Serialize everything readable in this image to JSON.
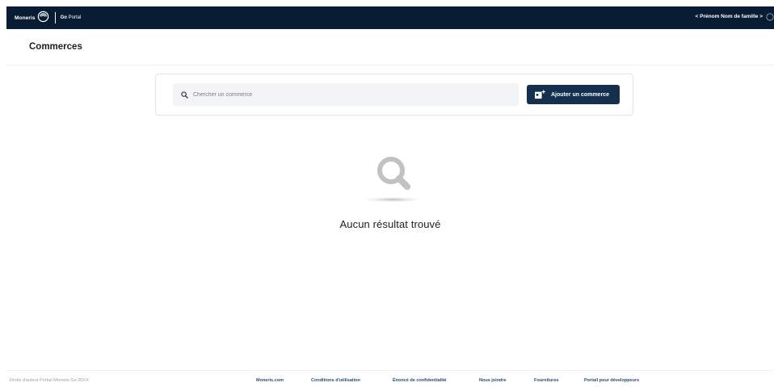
{
  "topbar": {
    "brand_name": "Moneris",
    "product_prefix": "Go",
    "product_name": "Portal",
    "user_label": "< Prénom Nom de famille >"
  },
  "page": {
    "title": "Commerces"
  },
  "search": {
    "placeholder": "Chercher un commerce",
    "value": ""
  },
  "actions": {
    "add_label": "Ajouter un commerce"
  },
  "empty_state": {
    "message": "Aucun résultat trouvé"
  },
  "footer": {
    "copyright": "Droits d'auteur Portail Moneris Go 20XX",
    "links": [
      "Moneris.com",
      "Conditions d'utilisation",
      "Énoncé de confidentialité",
      "Nous joindre",
      "Fournitures",
      "Portail pour développeurs"
    ]
  },
  "colors": {
    "topbar_bg": "#081d33",
    "primary_button": "#15304f",
    "link": "#2d4d6e",
    "search_bg": "#f3f4f6"
  },
  "icons": {
    "brand_logo": "moneris-logo-icon",
    "user": "user-circle-icon",
    "search": "search-icon",
    "add": "add-store-icon",
    "empty": "magnifier-icon"
  }
}
